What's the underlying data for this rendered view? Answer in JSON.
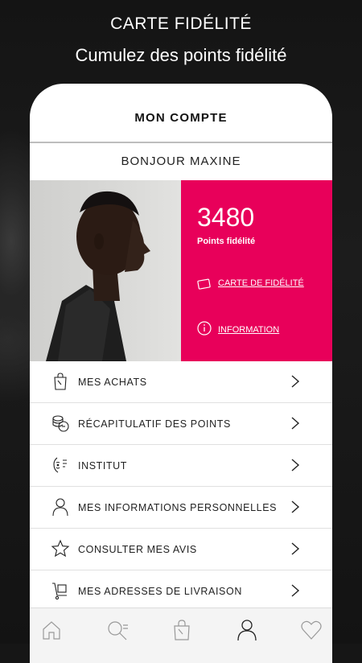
{
  "promo": {
    "title": "CARTE FIDÉLITÉ",
    "subtitle": "Cumulez des points fidélité"
  },
  "account": {
    "title": "MON COMPTE",
    "greeting": "BONJOUR MAXINE"
  },
  "loyalty": {
    "points": "3480",
    "points_label": "Points fidélité",
    "card_link": "CARTE DE FIDÉLITÉ",
    "info_link": "INFORMATION",
    "accent_color": "#e8005a"
  },
  "menu": [
    {
      "label": "MES ACHATS",
      "icon": "shopping-bag-icon"
    },
    {
      "label": "RÉCAPITULATIF DES POINTS",
      "icon": "coins-icon"
    },
    {
      "label": "INSTITUT",
      "icon": "face-icon"
    },
    {
      "label": "MES INFORMATIONS PERSONNELLES",
      "icon": "user-icon"
    },
    {
      "label": "CONSULTER MES AVIS",
      "icon": "star-icon"
    },
    {
      "label": "MES ADRESSES DE LIVRAISON",
      "icon": "delivery-icon"
    }
  ],
  "nav": [
    {
      "name": "home-icon"
    },
    {
      "name": "search-icon"
    },
    {
      "name": "bag-icon"
    },
    {
      "name": "account-icon",
      "active": true
    },
    {
      "name": "heart-icon"
    }
  ]
}
